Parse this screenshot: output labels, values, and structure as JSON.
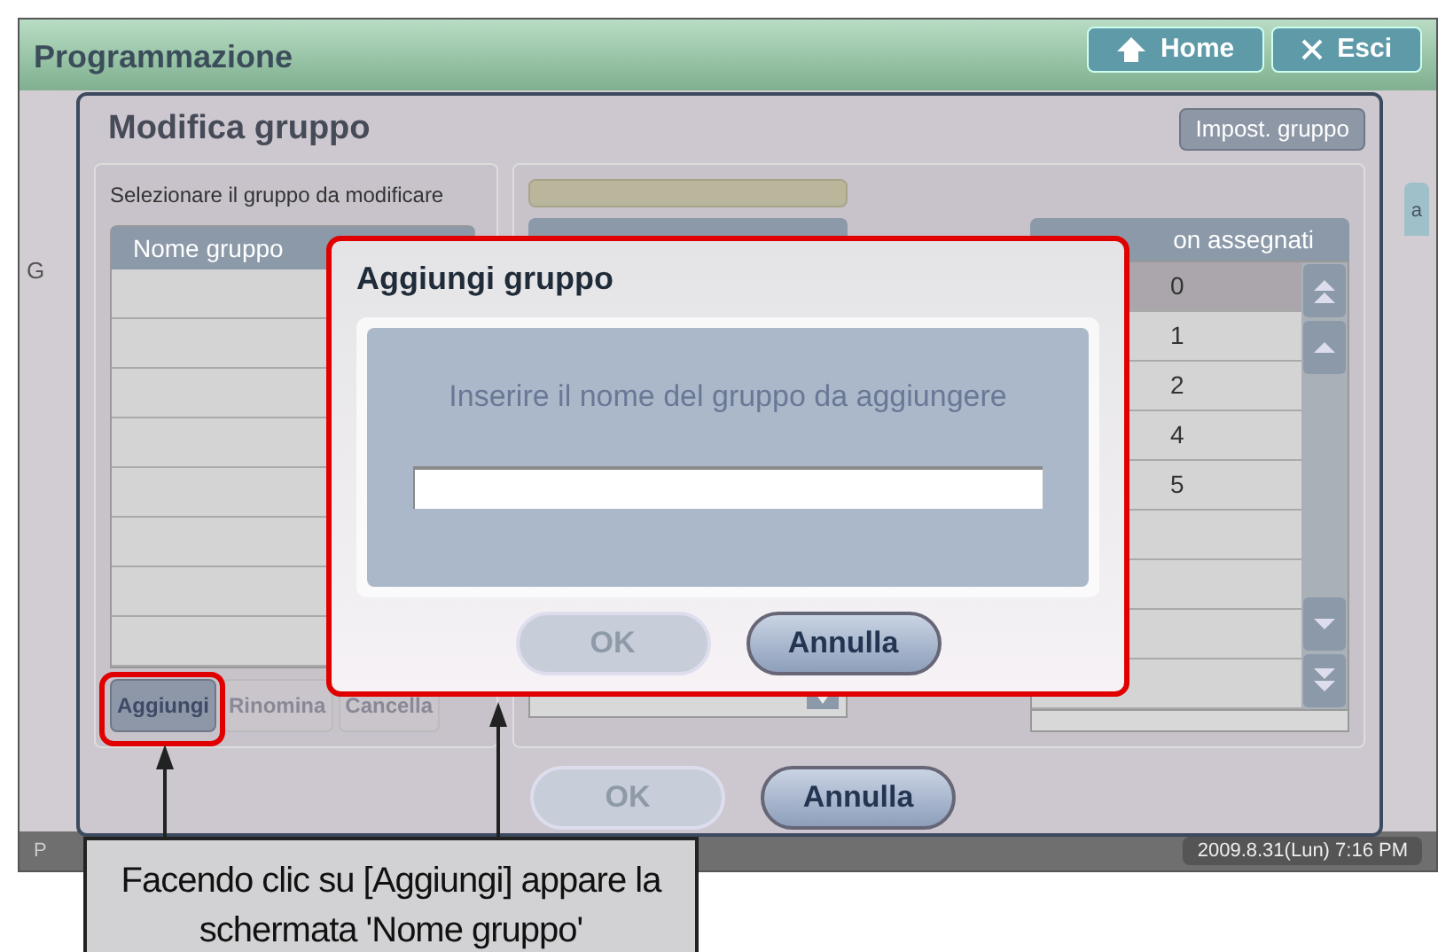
{
  "app": {
    "title": "Programmazione",
    "buttons": [
      {
        "kind": "home",
        "label": "Home"
      },
      {
        "kind": "exit",
        "label": "Esci"
      }
    ],
    "side_fragment": "G",
    "tab_fragment": "a",
    "status_bar": {
      "left": "P",
      "datetime": "2009.8.31(Lun)  7:16 PM"
    }
  },
  "edit_dialog": {
    "title": "Modifica gruppo",
    "settings_button": "Impost. gruppo",
    "prompt": "Selezionare il gruppo da modificare",
    "group_table": {
      "column": "Nome gruppo"
    },
    "group_buttons": [
      {
        "label": "Aggiungi",
        "disabled": false,
        "highlighted": true
      },
      {
        "label": "Rinomina",
        "disabled": true,
        "highlighted": false
      },
      {
        "label": "Cancella",
        "disabled": true,
        "highlighted": false
      }
    ],
    "unassigned": {
      "column": "on assegnati",
      "items": [
        {
          "text": "0",
          "selected": true
        },
        {
          "text": "1",
          "selected": false
        },
        {
          "text": "2",
          "selected": false
        },
        {
          "text": "4",
          "selected": false
        },
        {
          "text": "5",
          "selected": false
        }
      ]
    },
    "buttons": [
      {
        "label": "OK",
        "disabled": true
      },
      {
        "label": "Annulla",
        "disabled": false
      }
    ]
  },
  "add_dialog": {
    "title": "Aggiungi gruppo",
    "prompt": "Inserire il nome del gruppo da aggiungere",
    "buttons": [
      {
        "label": "OK",
        "disabled": true
      },
      {
        "label": "Annulla",
        "disabled": false
      }
    ]
  },
  "callout": {
    "text": "Facendo clic su [Aggiungi] appare la schermata 'Nome gruppo'"
  }
}
